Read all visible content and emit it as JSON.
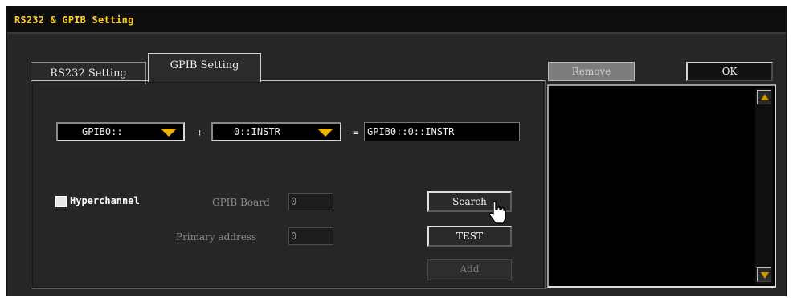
{
  "window": {
    "title": "RS232 & GPIB Setting"
  },
  "tabs": [
    {
      "label": "RS232 Setting",
      "active": false
    },
    {
      "label": "GPIB Setting",
      "active": true
    }
  ],
  "gpib": {
    "board_dropdown": "GPIB0::",
    "plus": "+",
    "address_dropdown": "0::INSTR",
    "equals": "=",
    "resource_string": "GPIB0::0::INSTR",
    "hyperchannel_label": "Hyperchannel",
    "hyperchannel_checked": false,
    "gpib_board_label": "GPIB Board",
    "gpib_board_value": "0",
    "primary_address_label": "Primary address",
    "primary_address_value": "0"
  },
  "buttons": {
    "search": "Search",
    "test": "TEST",
    "add": "Add",
    "remove": "Remove",
    "ok": "OK"
  },
  "colors": {
    "title": "#ffd21f",
    "dropdown_arrow": "#f0b400",
    "scroll_arrow": "#c79a00"
  },
  "icons": {
    "cursor": "hand-pointer-icon",
    "scroll_up": "triangle-up-icon",
    "scroll_down": "triangle-down-icon"
  }
}
